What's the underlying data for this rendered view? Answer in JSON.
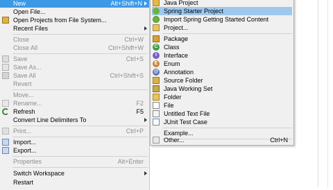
{
  "file_menu": {
    "items": [
      {
        "label": "New",
        "accel": "Alt+Shift+N",
        "submenu": true,
        "state": "selected"
      },
      {
        "label": "Open File...",
        "accel": "",
        "icon": "open-file-icon"
      },
      {
        "label": "Open Projects from File System...",
        "accel": "",
        "icon": "open-projects-icon"
      },
      {
        "label": "Recent Files",
        "accel": "",
        "submenu": true
      },
      {
        "label": "Close",
        "accel": "Ctrl+W",
        "disabled": true
      },
      {
        "label": "Close All",
        "accel": "Ctrl+Shift+W",
        "disabled": true
      },
      {
        "label": "Save",
        "accel": "Ctrl+S",
        "disabled": true,
        "icon": "save-icon"
      },
      {
        "label": "Save As...",
        "accel": "",
        "disabled": true,
        "icon": "save-as-icon"
      },
      {
        "label": "Save All",
        "accel": "Ctrl+Shift+S",
        "disabled": true,
        "icon": "save-all-icon"
      },
      {
        "label": "Revert",
        "accel": "",
        "disabled": true
      },
      {
        "label": "Move...",
        "accel": "",
        "disabled": true
      },
      {
        "label": "Rename...",
        "accel": "F2",
        "disabled": true,
        "icon": "rename-icon"
      },
      {
        "label": "Refresh",
        "accel": "F5",
        "icon": "refresh-icon"
      },
      {
        "label": "Convert Line Delimiters To",
        "accel": "",
        "submenu": true
      },
      {
        "label": "Print...",
        "accel": "Ctrl+P",
        "disabled": true,
        "icon": "print-icon"
      },
      {
        "label": "Import...",
        "accel": "",
        "icon": "import-icon"
      },
      {
        "label": "Export...",
        "accel": "",
        "icon": "export-icon"
      },
      {
        "label": "Properties",
        "accel": "Alt+Enter",
        "disabled": true
      },
      {
        "label": "Switch Workspace",
        "accel": "",
        "submenu": true
      },
      {
        "label": "Restart",
        "accel": ""
      }
    ]
  },
  "new_submenu": {
    "items": [
      {
        "label": "Java Project",
        "accel": "",
        "icon": "java-project-icon"
      },
      {
        "label": "Spring Starter Project",
        "accel": "",
        "icon": "spring-starter-icon",
        "state": "hover"
      },
      {
        "label": "Import Spring Getting Started Content",
        "accel": "",
        "icon": "spring-import-icon"
      },
      {
        "label": "Project...",
        "accel": "",
        "icon": "project-icon"
      },
      {
        "label": "Package",
        "accel": "",
        "icon": "package-icon"
      },
      {
        "label": "Class",
        "accel": "",
        "icon": "class-icon"
      },
      {
        "label": "Interface",
        "accel": "",
        "icon": "interface-icon"
      },
      {
        "label": "Enum",
        "accel": "",
        "icon": "enum-icon"
      },
      {
        "label": "Annotation",
        "accel": "",
        "icon": "annotation-icon"
      },
      {
        "label": "Source Folder",
        "accel": "",
        "icon": "source-folder-icon"
      },
      {
        "label": "Java Working Set",
        "accel": "",
        "icon": "working-set-icon"
      },
      {
        "label": "Folder",
        "accel": "",
        "icon": "folder-icon"
      },
      {
        "label": "File",
        "accel": "",
        "icon": "file-icon"
      },
      {
        "label": "Untitled Text File",
        "accel": "",
        "icon": "untitled-text-file-icon"
      },
      {
        "label": "JUnit Test Case",
        "accel": "",
        "icon": "junit-icon"
      },
      {
        "label": "Example...",
        "accel": "",
        "icon": "example-icon"
      },
      {
        "label": "Other...",
        "accel": "Ctrl+N",
        "icon": "other-icon"
      }
    ]
  },
  "colors": {
    "menu_bg": "#f0f0f0",
    "selected_bg": "#3c99e6",
    "hover_bg": "#9fc8ee",
    "disabled_text": "#8d8d8d",
    "separator": "#d2d2d2"
  }
}
